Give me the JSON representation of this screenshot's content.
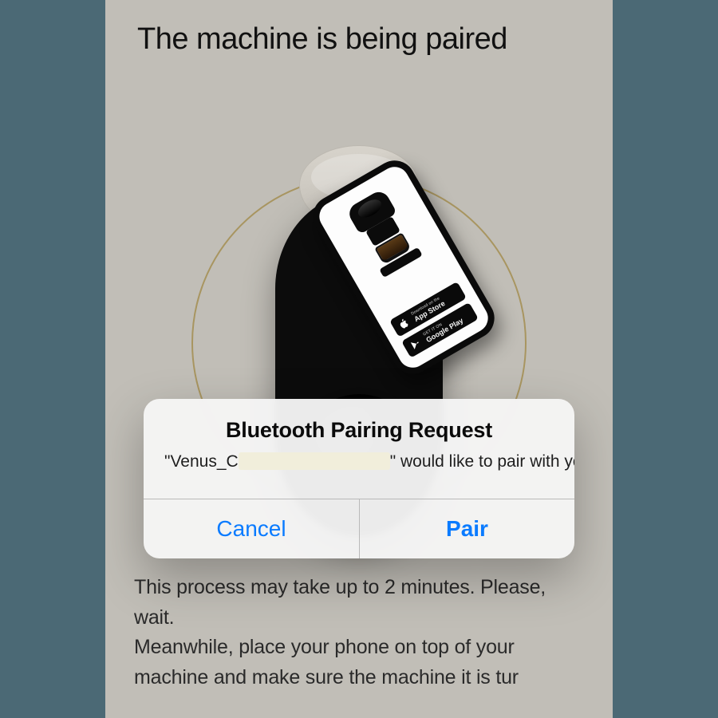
{
  "page": {
    "title": "The machine is being paired",
    "description_line1": "This process may take up to 2 minutes. Please, wait.",
    "description_line2": "Meanwhile, place your phone on top of your machine and make sure the machine it is tur"
  },
  "phone_mockup": {
    "app_store": {
      "small": "Download on the",
      "large": "App Store"
    },
    "google_play": {
      "small": "GET IT ON",
      "large": "Google Play"
    }
  },
  "alert": {
    "title": "Bluetooth Pairing Request",
    "device_prefix": "\"Venus_C",
    "device_suffix": "\" would like to pair with your iPhone.",
    "cancel": "Cancel",
    "confirm": "Pair"
  }
}
